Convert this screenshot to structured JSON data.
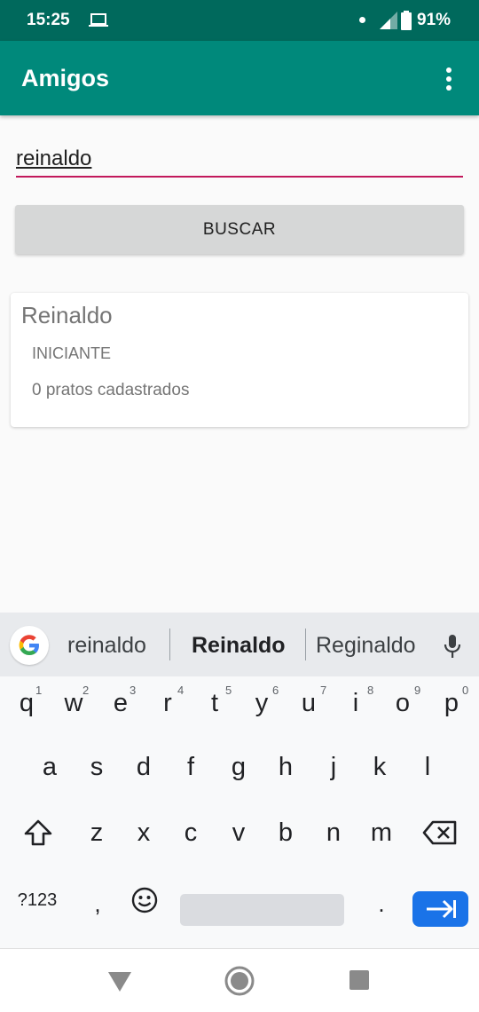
{
  "status_bar": {
    "time": "15:25",
    "battery": "91%"
  },
  "app_bar": {
    "title": "Amigos"
  },
  "search": {
    "value": "reinaldo",
    "button_label": "BUSCAR"
  },
  "result_card": {
    "name": "Reinaldo",
    "level": "INICIANTE",
    "dishes": "0 pratos cadastrados"
  },
  "keyboard": {
    "suggestions": [
      "reinaldo",
      "Reinaldo",
      "Reginaldo"
    ],
    "row1": [
      "q",
      "w",
      "e",
      "r",
      "t",
      "y",
      "u",
      "i",
      "o",
      "p"
    ],
    "row1_hints": [
      "1",
      "2",
      "3",
      "4",
      "5",
      "6",
      "7",
      "8",
      "9",
      "0"
    ],
    "row2": [
      "a",
      "s",
      "d",
      "f",
      "g",
      "h",
      "j",
      "k",
      "l"
    ],
    "row3": [
      "z",
      "x",
      "c",
      "v",
      "b",
      "n",
      "m"
    ],
    "symbols_label": "?123",
    "comma": ",",
    "period": "."
  },
  "colors": {
    "status_bar": "#00695c",
    "app_bar": "#00897b",
    "accent": "#c2185b",
    "enter_key": "#1a73e8"
  },
  "icons": [
    "laptop-icon",
    "signal-icon",
    "battery-icon",
    "overflow-menu-icon",
    "google-icon",
    "microphone-icon",
    "shift-icon",
    "backspace-icon",
    "emoji-icon",
    "enter-icon",
    "back-icon",
    "home-icon",
    "recents-icon"
  ]
}
